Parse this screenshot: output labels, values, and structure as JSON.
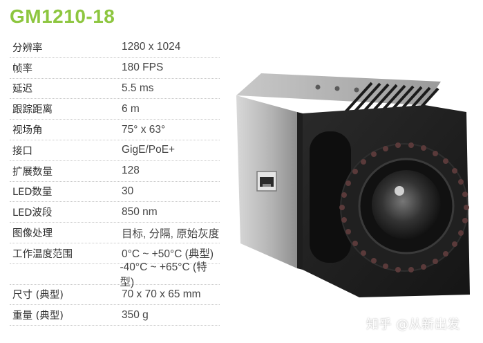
{
  "title": "GM1210-18",
  "specs": [
    {
      "label": "分辨率",
      "value": "1280 x 1024"
    },
    {
      "label": "帧率",
      "value": "180 FPS"
    },
    {
      "label": "延迟",
      "value": "5.5 ms"
    },
    {
      "label": "跟踪距离",
      "value": "6 m"
    },
    {
      "label": "视场角",
      "value": "75° x 63°"
    },
    {
      "label": "接口",
      "value": "GigE/PoE+"
    },
    {
      "label": "扩展数量",
      "value": "128"
    },
    {
      "label": "LED数量",
      "value": "30"
    },
    {
      "label": "LED波段",
      "value": "850 nm"
    },
    {
      "label": "图像处理",
      "value": "目标, 分隔, 原始灰度"
    },
    {
      "label": "工作温度范围",
      "value": "0°C ~ +50°C (典型)"
    },
    {
      "label": "",
      "value": "-40°C ~ +65°C (特型)"
    },
    {
      "label": "尺寸 (典型)",
      "value": "70 x 70 x 65 mm"
    },
    {
      "label": "重量 (典型)",
      "value": "350 g"
    }
  ],
  "watermark": "知乎 @从新出发"
}
